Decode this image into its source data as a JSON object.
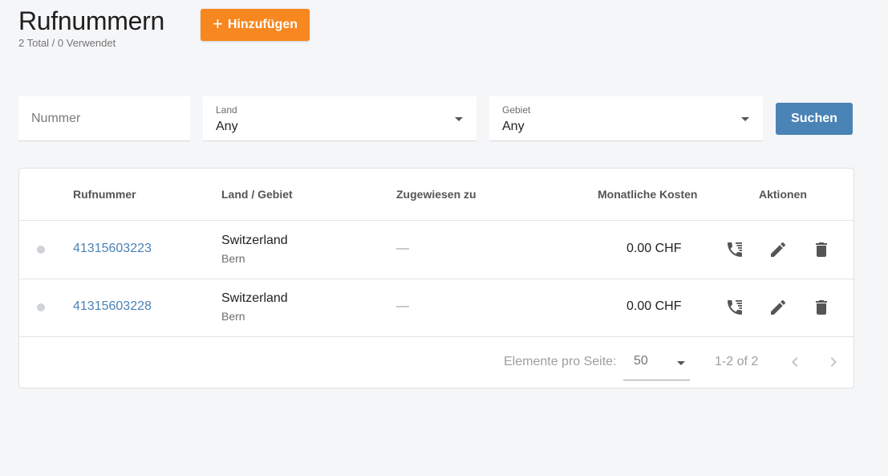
{
  "header": {
    "title": "Rufnummern",
    "subtitle": "2 Total / 0 Verwendet",
    "add_button_icon": "plus-icon",
    "add_button_label": "Hinzufügen",
    "add_button_color": "#f7871f"
  },
  "filters": {
    "number_placeholder": "Nummer",
    "land": {
      "label": "Land",
      "value": "Any"
    },
    "area": {
      "label": "Gebiet",
      "value": "Any"
    },
    "search_label": "Suchen",
    "search_color": "#4a83b5"
  },
  "table": {
    "columns": [
      "Rufnummer",
      "Land / Gebiet",
      "Zugewiesen zu",
      "Monatliche Kosten",
      "Aktionen"
    ],
    "rows": [
      {
        "number": "41315603223",
        "country": "Switzerland",
        "region": "Bern",
        "assigned": "—",
        "cost": "0.00 CHF",
        "status": "inactive"
      },
      {
        "number": "41315603228",
        "country": "Switzerland",
        "region": "Bern",
        "assigned": "—",
        "cost": "0.00 CHF",
        "status": "inactive"
      }
    ],
    "actions": [
      "call-routing-icon",
      "edit-icon",
      "delete-icon"
    ]
  },
  "pagination": {
    "label": "Elemente pro Seite:",
    "per_page": "50",
    "range": "1-2 of 2"
  }
}
